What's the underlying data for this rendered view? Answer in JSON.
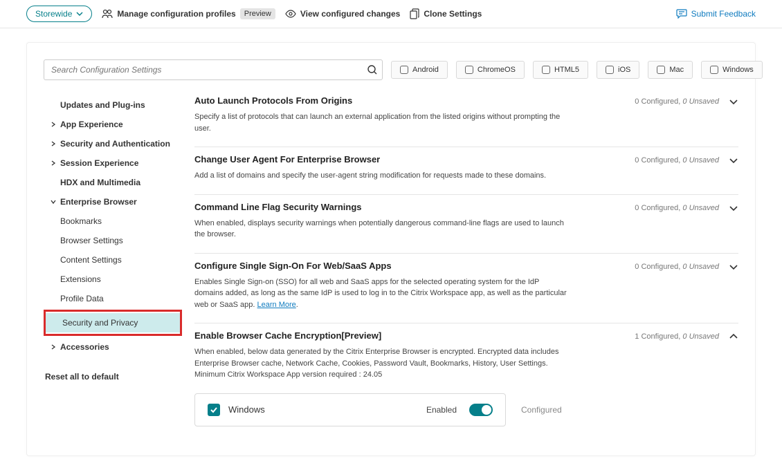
{
  "header": {
    "scope": "Storewide",
    "manage": "Manage configuration profiles",
    "preview": "Preview",
    "view": "View configured changes",
    "clone": "Clone Settings",
    "feedback": "Submit Feedback"
  },
  "search": {
    "placeholder": "Search Configuration Settings"
  },
  "os": [
    "Android",
    "ChromeOS",
    "HTML5",
    "iOS",
    "Mac",
    "Windows"
  ],
  "side": {
    "updates": "Updates and Plug-ins",
    "appexp": "App Experience",
    "secauth": "Security and Authentication",
    "session": "Session Experience",
    "hdx": "HDX and Multimedia",
    "eb": "Enterprise Browser",
    "eb_children": {
      "bookmarks": "Bookmarks",
      "browser": "Browser Settings",
      "content": "Content Settings",
      "ext": "Extensions",
      "profile": "Profile Data",
      "secpriv": "Security and Privacy"
    },
    "accessories": "Accessories",
    "reset": "Reset all to default"
  },
  "settings": [
    {
      "id": "auto-launch",
      "title": "Auto Launch Protocols From Origins",
      "desc": "Specify a list of protocols that can launch an external application from the listed origins without prompting the user.",
      "configured": 0,
      "unsaved": 0,
      "expanded": false
    },
    {
      "id": "user-agent",
      "title": "Change User Agent For Enterprise Browser",
      "desc": "Add a list of domains and specify the user-agent string modification for requests made to these domains.",
      "configured": 0,
      "unsaved": 0,
      "expanded": false
    },
    {
      "id": "cmd-flag",
      "title": "Command Line Flag Security Warnings",
      "desc": "When enabled, displays security warnings when potentially dangerous command-line flags are used to launch the browser.",
      "configured": 0,
      "unsaved": 0,
      "expanded": false
    },
    {
      "id": "sso",
      "title": "Configure Single Sign-On For Web/SaaS Apps",
      "desc": "Enables Single Sign-on (SSO) for all web and SaaS apps for the selected operating system for the IdP domains added, as long as the same IdP is used to log in to the Citrix Workspace app, as well as the particular web or SaaS app.",
      "link": "Learn More",
      "configured": 0,
      "unsaved": 0,
      "expanded": false
    },
    {
      "id": "cache-enc",
      "title": "Enable Browser Cache Encryption[Preview]",
      "desc": "When enabled, below data generated by the Citrix Enterprise Browser is encrypted. Encrypted data includes Enterprise Browser cache, Network Cache, Cookies, Password Vault, Bookmarks, History, User Settings. Minimum Citrix Workspace App version required : 24.05",
      "configured": 1,
      "unsaved": 0,
      "expanded": true
    }
  ],
  "panel": {
    "os": "Windows",
    "enabled_label": "Enabled",
    "configured": "Configured"
  }
}
